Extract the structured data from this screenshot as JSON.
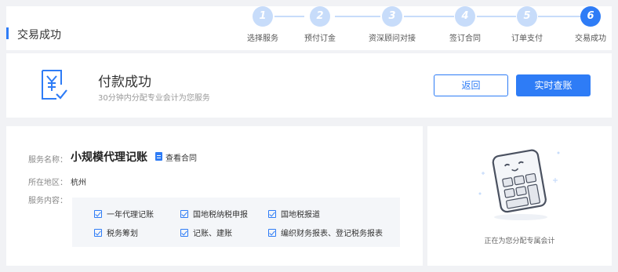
{
  "page_title": "交易成功",
  "steps": [
    {
      "num": "1",
      "label": "选择服务",
      "active": false
    },
    {
      "num": "2",
      "label": "预付订金",
      "active": false
    },
    {
      "num": "3",
      "label": "资深顾问对接",
      "active": false
    },
    {
      "num": "4",
      "label": "签订合同",
      "active": false
    },
    {
      "num": "5",
      "label": "订单支付",
      "active": false
    },
    {
      "num": "6",
      "label": "交易成功",
      "active": true
    }
  ],
  "success": {
    "icon": "yuan-check-document-icon",
    "title": "付款成功",
    "subtitle": "30分钟内分配专业会计为您服务",
    "back_label": "返回",
    "check_label": "实时查账"
  },
  "detail": {
    "service_name_label": "服务名称：",
    "service_name": "小规模代理记账",
    "contract_link": "查看合同",
    "region_label": "所在地区：",
    "region_value": "杭州",
    "content_label": "服务内容：",
    "items": [
      "一年代理记账",
      "国地税纳税申报",
      "国地税报道",
      "税务筹划",
      "记账、建账",
      "编织财务报表、登记税务报表"
    ]
  },
  "assign": {
    "illustration": "smiling-calculator-icon",
    "text": "正在为您分配专属会计"
  },
  "colors": {
    "accent": "#2e7cf6",
    "step_inactive": "#c7dcfa",
    "background": "#f1f2f5"
  }
}
